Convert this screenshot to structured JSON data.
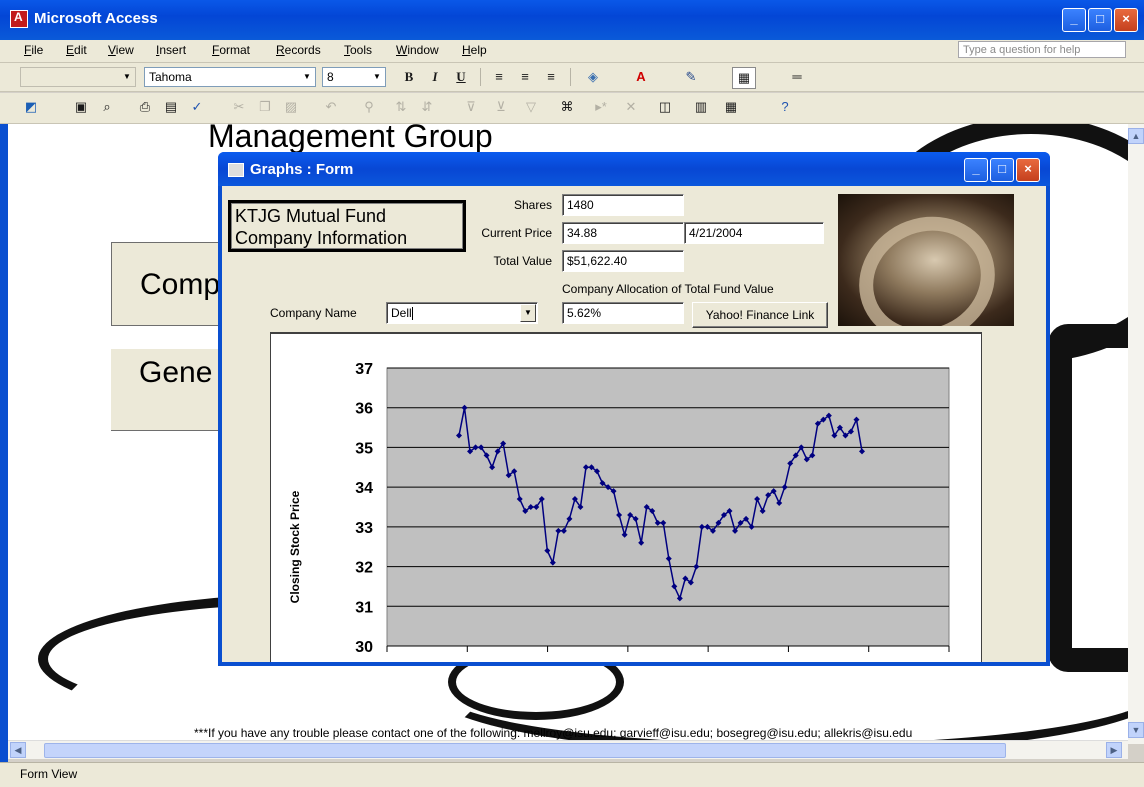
{
  "app": {
    "title": "Microsoft Access"
  },
  "menu": [
    "File",
    "Edit",
    "View",
    "Insert",
    "Format",
    "Records",
    "Tools",
    "Window",
    "Help"
  ],
  "question_box": {
    "placeholder": "Type a question for help"
  },
  "format_toolbar": {
    "font_name": "Tahoma",
    "font_size": "8"
  },
  "background_form": {
    "heading": "Management Group",
    "panel_1": "Comp",
    "panel_2": "Gene",
    "trouble_text": "***If you have any trouble please contact one of the following: mellroy@isu.edu; garvieff@isu.edu; bosegreg@isu.edu; allekris@isu.edu"
  },
  "status_bar": {
    "text": "Form View"
  },
  "form": {
    "title": "Graphs : Form",
    "fund_title_line1": "KTJG Mutual Fund",
    "fund_title_line2": "Company Information",
    "shares_label": "Shares",
    "shares_value": "1480",
    "current_price_label": "Current Price",
    "current_price_value": "34.88",
    "date_value": "4/21/2004",
    "total_value_label": "Total Value",
    "total_value_value": "$51,622.40",
    "allocation_label": "Company Allocation of Total Fund Value",
    "allocation_value": "5.62%",
    "company_name_label": "Company Name",
    "company_name_value": "Dell",
    "yahoo_button": "Yahoo! Finance Link"
  },
  "chart_data": {
    "type": "line",
    "ylabel": "Closing Stock Price",
    "xlabel": "",
    "ylim": [
      30,
      37
    ],
    "yticks": [
      "30",
      "31",
      "32",
      "33",
      "34",
      "35",
      "36",
      "37"
    ],
    "grid": true,
    "color": "#000080",
    "series": [
      {
        "values": [
          35.3,
          36.0,
          34.9,
          35.0,
          35.0,
          34.8,
          34.5,
          34.9,
          35.1,
          34.3,
          34.4,
          33.7,
          33.4,
          33.5,
          33.5,
          33.7,
          32.4,
          32.1,
          32.9,
          32.9,
          33.2,
          33.7,
          33.5,
          34.5,
          34.5,
          34.4,
          34.1,
          34.0,
          33.9,
          33.3,
          32.8,
          33.3,
          33.2,
          32.6,
          33.5,
          33.4,
          33.1,
          33.1,
          32.2,
          31.5,
          31.2,
          31.7,
          31.6,
          32.0,
          33.0,
          33.0,
          32.9,
          33.1,
          33.3,
          33.4,
          32.9,
          33.1,
          33.2,
          33.0,
          33.7,
          33.4,
          33.8,
          33.9,
          33.6,
          34.0,
          34.6,
          34.8,
          35.0,
          34.7,
          34.8,
          35.6,
          35.7,
          35.8,
          35.3,
          35.5,
          35.3,
          35.4,
          35.7,
          34.9
        ]
      }
    ]
  }
}
